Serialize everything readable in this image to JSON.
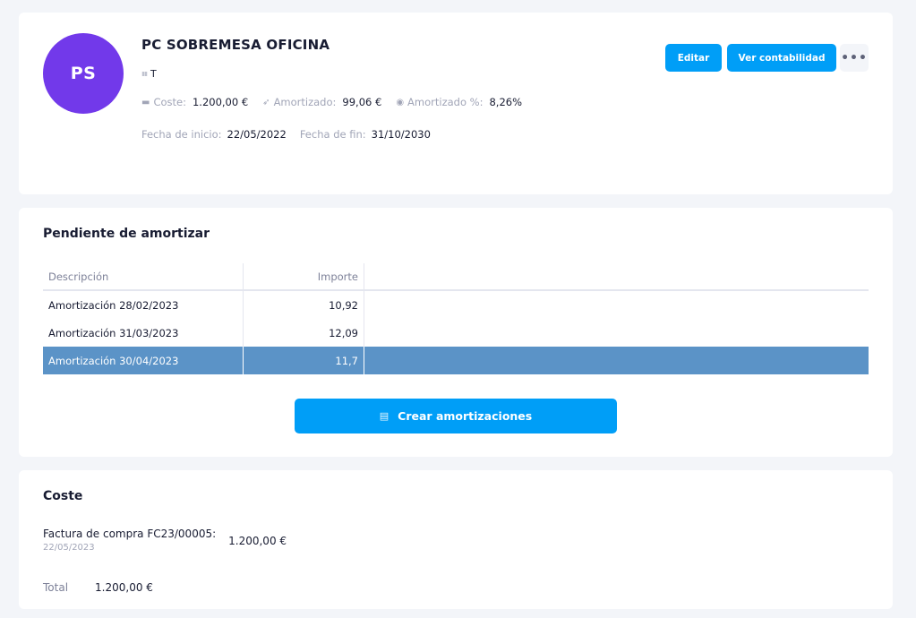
{
  "asset": {
    "initials": "PS",
    "avatar_color": "#7239ea",
    "title": "PC SOBREMESA OFICINA",
    "barcode_icon": "barcode-icon",
    "barcode": "T",
    "cost_label": "Coste:",
    "cost_value": "1.200,00 €",
    "amortized_label": "Amortizado:",
    "amortized_value": "99,06 €",
    "amortized_pct_label": "Amortizado %:",
    "amortized_pct_value": "8,26%",
    "amortized_pct": 8.26,
    "start_label": "Fecha de inicio:",
    "start_value": "22/05/2022",
    "end_label": "Fecha de fin:",
    "end_value": "31/10/2030"
  },
  "toolbar": {
    "edit_label": "Editar",
    "accounting_label": "Ver contabilidad",
    "more_label": "•••"
  },
  "pending": {
    "title": "Pendiente de amortizar",
    "columns": [
      "Descripción",
      "Importe"
    ],
    "rows": [
      {
        "description": "Amortización 28/02/2023",
        "amount": "10,92"
      },
      {
        "description": "Amortización 31/03/2023",
        "amount": "12,09"
      },
      {
        "description": "Amortización 30/04/2023",
        "amount": "11,7"
      }
    ],
    "selected_row": 2,
    "create_label": "Crear amortizaciones"
  },
  "cost": {
    "title": "Coste",
    "invoice_label": "Factura de compra FC23/00005:",
    "invoice_date": "22/05/2023",
    "invoice_amount": "1.200,00 €",
    "total_label": "Total",
    "total_value": "1.200,00 €"
  },
  "colors": {
    "primary": "#009ef7",
    "avatar": "#7239ea",
    "selected_row": "#5b93c7",
    "page_bg": "#f3f5f9"
  }
}
